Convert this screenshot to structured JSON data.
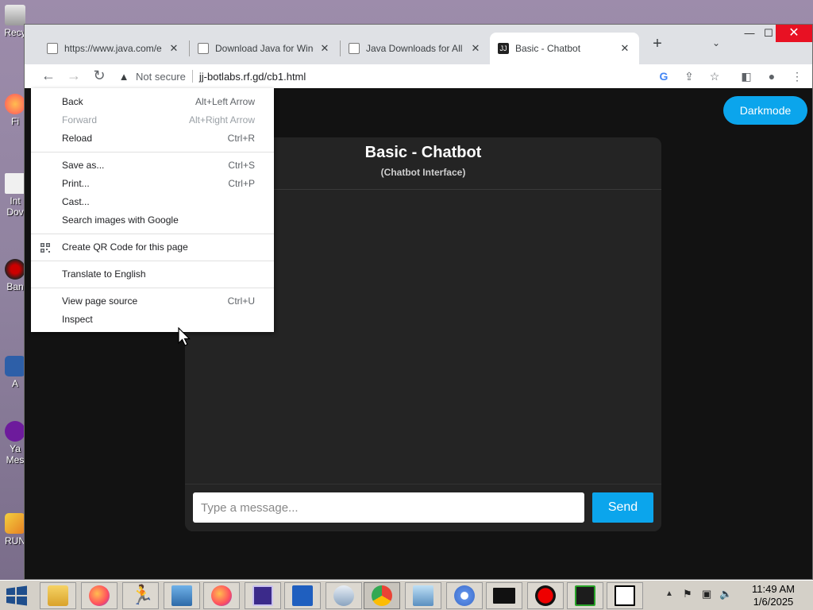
{
  "desktop": {
    "icons": [
      {
        "label": "Recy",
        "icon": "recycle-bin-icon"
      },
      {
        "label": "Fi",
        "icon": "firefox-shortcut-icon"
      },
      {
        "label": "Int",
        "sub": "Dov",
        "icon": "download-shortcut-icon"
      },
      {
        "label": "Ban",
        "icon": "app-shortcut-icon"
      },
      {
        "label": "A",
        "icon": "app-shortcut-icon"
      },
      {
        "label": "Ya",
        "sub": "Mes",
        "icon": "yahoo-messenger-icon"
      },
      {
        "label": "RUN",
        "icon": "run-shortcut-icon"
      }
    ]
  },
  "browser": {
    "tabs": [
      {
        "title": "https://www.java.com/e",
        "icon": "java-favicon",
        "active": false
      },
      {
        "title": "Download Java for Wind",
        "icon": "java-favicon",
        "active": false
      },
      {
        "title": "Java Downloads for All C",
        "icon": "java-favicon",
        "active": false
      },
      {
        "title": "Basic - Chatbot",
        "icon": "jj-favicon",
        "active": true
      }
    ],
    "favicon_text": "JJ",
    "security_label": "Not secure",
    "url": "jj-botlabs.rf.gd/cb1.html"
  },
  "page": {
    "darkmode_label": "Darkmode",
    "chat_title": "Basic - Chatbot",
    "chat_subtitle": "(Chatbot Interface)",
    "input_placeholder": "Type a message...",
    "send_label": "Send",
    "accent_color": "#0ba5ec"
  },
  "context_menu": {
    "groups": [
      [
        {
          "label": "Back",
          "shortcut": "Alt+Left Arrow",
          "enabled": true
        },
        {
          "label": "Forward",
          "shortcut": "Alt+Right Arrow",
          "enabled": false
        },
        {
          "label": "Reload",
          "shortcut": "Ctrl+R",
          "enabled": true
        }
      ],
      [
        {
          "label": "Save as...",
          "shortcut": "Ctrl+S",
          "enabled": true
        },
        {
          "label": "Print...",
          "shortcut": "Ctrl+P",
          "enabled": true
        },
        {
          "label": "Cast...",
          "shortcut": "",
          "enabled": true
        },
        {
          "label": "Search images with Google",
          "shortcut": "",
          "enabled": true
        }
      ],
      [
        {
          "label": "Create QR Code for this page",
          "shortcut": "",
          "enabled": true,
          "icon": "qr-code-icon"
        }
      ],
      [
        {
          "label": "Translate to English",
          "shortcut": "",
          "enabled": true
        }
      ],
      [
        {
          "label": "View page source",
          "shortcut": "Ctrl+U",
          "enabled": true
        },
        {
          "label": "Inspect",
          "shortcut": "",
          "enabled": true
        }
      ]
    ]
  },
  "taskbar": {
    "apps": [
      "file-explorer-icon",
      "firefox-icon",
      "running-man-icon",
      "image-viewer-icon",
      "firefox-icon",
      "cpu-app-icon",
      "powershell-icon",
      "media-icon",
      "chrome-icon",
      "network-icon",
      "chromium-icon",
      "command-prompt-icon",
      "record-icon",
      "terminal-icon",
      "7zip-icon"
    ],
    "time": "11:49 AM",
    "date": "1/6/2025"
  }
}
